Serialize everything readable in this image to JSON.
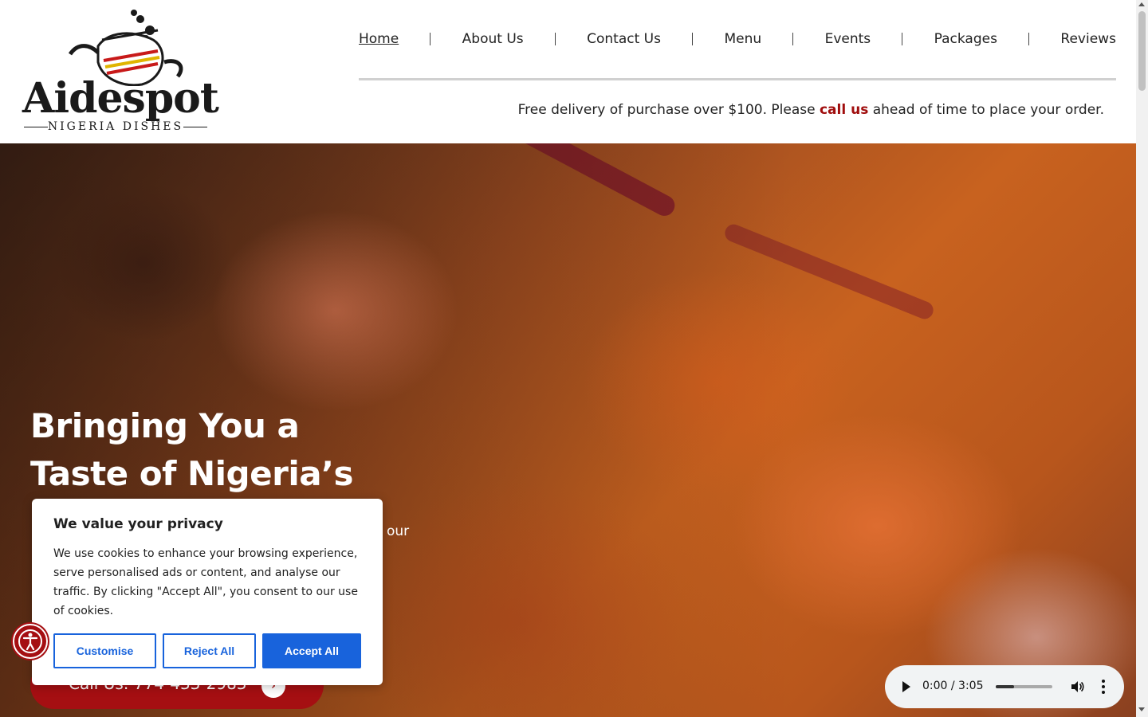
{
  "header": {
    "logo": {
      "brand": "Aidespot",
      "subtitle": "NIGERIA DISHES"
    },
    "nav": [
      {
        "label": "Home",
        "active": true
      },
      {
        "label": "About Us"
      },
      {
        "label": "Contact Us"
      },
      {
        "label": "Menu"
      },
      {
        "label": "Events"
      },
      {
        "label": "Packages"
      },
      {
        "label": "Reviews"
      }
    ],
    "promo": {
      "before": "Free delivery of purchase over $100. Please ",
      "link": "call us",
      "after": " ahead of time to place your order."
    }
  },
  "hero": {
    "title": "Bringing You a Taste of Nigeria’s Best",
    "text_fragment": "our",
    "cta_label": "Call Us: 774-433-2983",
    "cta_icon": "chevron-right-icon"
  },
  "cookie_banner": {
    "title": "We value your privacy",
    "text": "We use cookies to enhance your browsing experience, serve personalised ads or content, and analyse our traffic. By clicking \"Accept All\", you consent to our use of cookies.",
    "customise_label": "Customise",
    "reject_label": "Reject All",
    "accept_label": "Accept All"
  },
  "audio_player": {
    "time": "0:00 / 3:05",
    "volume_level": 0.33
  },
  "colors": {
    "accent": "#a50f12",
    "link_red": "#a00d0d",
    "cookie_blue": "#1863dc"
  }
}
